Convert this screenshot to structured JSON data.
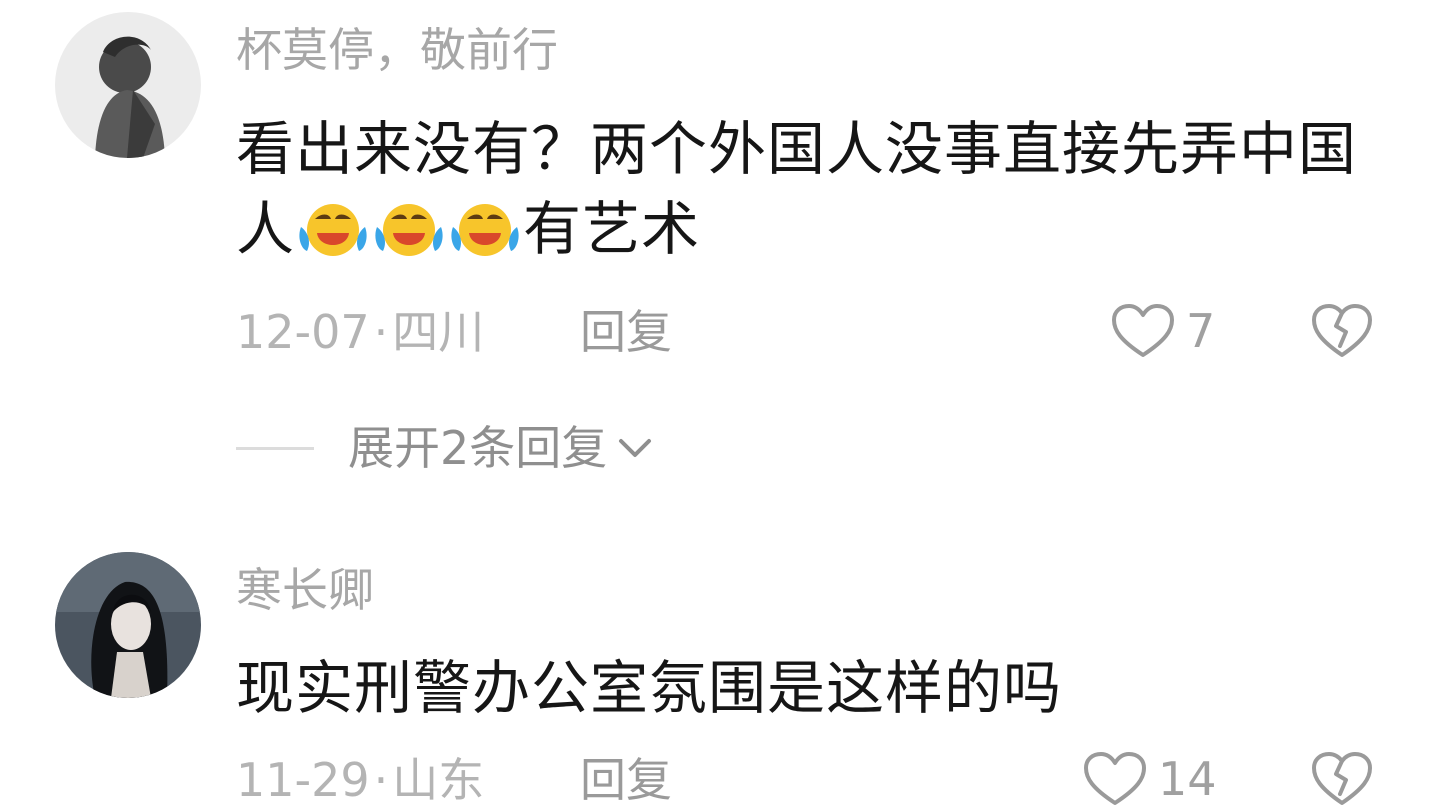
{
  "comments": [
    {
      "username": "杯莫停，敬前行",
      "text_before_emoji": "看出来没有？两个外国人没事直接先弄中国人",
      "emoji": "laugh-cry-emoji",
      "emoji_count": 3,
      "text_after_emoji": "有艺术",
      "date": "12-07",
      "separator": "·",
      "location": "四川",
      "reply_label": "回复",
      "like_count": "7",
      "expand_label": "展开2条回复"
    },
    {
      "username": "寒长卿",
      "text": "现实刑警办公室氛围是这样的吗",
      "date": "11-29",
      "separator": "·",
      "location": "山东",
      "reply_label": "回复",
      "like_count": "14"
    }
  ],
  "colors": {
    "username": "#a7a7a7",
    "body_text": "#161616",
    "meta": "#b4b4b4",
    "icon": "#9a9a9a",
    "background": "#ffffff"
  }
}
